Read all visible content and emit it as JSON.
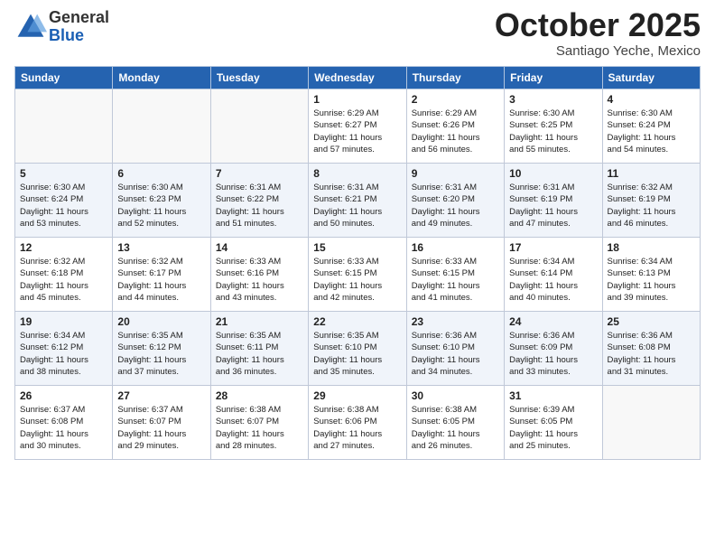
{
  "header": {
    "logo_general": "General",
    "logo_blue": "Blue",
    "month": "October 2025",
    "location": "Santiago Yeche, Mexico"
  },
  "weekdays": [
    "Sunday",
    "Monday",
    "Tuesday",
    "Wednesday",
    "Thursday",
    "Friday",
    "Saturday"
  ],
  "weeks": [
    [
      {
        "day": "",
        "info": ""
      },
      {
        "day": "",
        "info": ""
      },
      {
        "day": "",
        "info": ""
      },
      {
        "day": "1",
        "info": "Sunrise: 6:29 AM\nSunset: 6:27 PM\nDaylight: 11 hours\nand 57 minutes."
      },
      {
        "day": "2",
        "info": "Sunrise: 6:29 AM\nSunset: 6:26 PM\nDaylight: 11 hours\nand 56 minutes."
      },
      {
        "day": "3",
        "info": "Sunrise: 6:30 AM\nSunset: 6:25 PM\nDaylight: 11 hours\nand 55 minutes."
      },
      {
        "day": "4",
        "info": "Sunrise: 6:30 AM\nSunset: 6:24 PM\nDaylight: 11 hours\nand 54 minutes."
      }
    ],
    [
      {
        "day": "5",
        "info": "Sunrise: 6:30 AM\nSunset: 6:24 PM\nDaylight: 11 hours\nand 53 minutes."
      },
      {
        "day": "6",
        "info": "Sunrise: 6:30 AM\nSunset: 6:23 PM\nDaylight: 11 hours\nand 52 minutes."
      },
      {
        "day": "7",
        "info": "Sunrise: 6:31 AM\nSunset: 6:22 PM\nDaylight: 11 hours\nand 51 minutes."
      },
      {
        "day": "8",
        "info": "Sunrise: 6:31 AM\nSunset: 6:21 PM\nDaylight: 11 hours\nand 50 minutes."
      },
      {
        "day": "9",
        "info": "Sunrise: 6:31 AM\nSunset: 6:20 PM\nDaylight: 11 hours\nand 49 minutes."
      },
      {
        "day": "10",
        "info": "Sunrise: 6:31 AM\nSunset: 6:19 PM\nDaylight: 11 hours\nand 47 minutes."
      },
      {
        "day": "11",
        "info": "Sunrise: 6:32 AM\nSunset: 6:19 PM\nDaylight: 11 hours\nand 46 minutes."
      }
    ],
    [
      {
        "day": "12",
        "info": "Sunrise: 6:32 AM\nSunset: 6:18 PM\nDaylight: 11 hours\nand 45 minutes."
      },
      {
        "day": "13",
        "info": "Sunrise: 6:32 AM\nSunset: 6:17 PM\nDaylight: 11 hours\nand 44 minutes."
      },
      {
        "day": "14",
        "info": "Sunrise: 6:33 AM\nSunset: 6:16 PM\nDaylight: 11 hours\nand 43 minutes."
      },
      {
        "day": "15",
        "info": "Sunrise: 6:33 AM\nSunset: 6:15 PM\nDaylight: 11 hours\nand 42 minutes."
      },
      {
        "day": "16",
        "info": "Sunrise: 6:33 AM\nSunset: 6:15 PM\nDaylight: 11 hours\nand 41 minutes."
      },
      {
        "day": "17",
        "info": "Sunrise: 6:34 AM\nSunset: 6:14 PM\nDaylight: 11 hours\nand 40 minutes."
      },
      {
        "day": "18",
        "info": "Sunrise: 6:34 AM\nSunset: 6:13 PM\nDaylight: 11 hours\nand 39 minutes."
      }
    ],
    [
      {
        "day": "19",
        "info": "Sunrise: 6:34 AM\nSunset: 6:12 PM\nDaylight: 11 hours\nand 38 minutes."
      },
      {
        "day": "20",
        "info": "Sunrise: 6:35 AM\nSunset: 6:12 PM\nDaylight: 11 hours\nand 37 minutes."
      },
      {
        "day": "21",
        "info": "Sunrise: 6:35 AM\nSunset: 6:11 PM\nDaylight: 11 hours\nand 36 minutes."
      },
      {
        "day": "22",
        "info": "Sunrise: 6:35 AM\nSunset: 6:10 PM\nDaylight: 11 hours\nand 35 minutes."
      },
      {
        "day": "23",
        "info": "Sunrise: 6:36 AM\nSunset: 6:10 PM\nDaylight: 11 hours\nand 34 minutes."
      },
      {
        "day": "24",
        "info": "Sunrise: 6:36 AM\nSunset: 6:09 PM\nDaylight: 11 hours\nand 33 minutes."
      },
      {
        "day": "25",
        "info": "Sunrise: 6:36 AM\nSunset: 6:08 PM\nDaylight: 11 hours\nand 31 minutes."
      }
    ],
    [
      {
        "day": "26",
        "info": "Sunrise: 6:37 AM\nSunset: 6:08 PM\nDaylight: 11 hours\nand 30 minutes."
      },
      {
        "day": "27",
        "info": "Sunrise: 6:37 AM\nSunset: 6:07 PM\nDaylight: 11 hours\nand 29 minutes."
      },
      {
        "day": "28",
        "info": "Sunrise: 6:38 AM\nSunset: 6:07 PM\nDaylight: 11 hours\nand 28 minutes."
      },
      {
        "day": "29",
        "info": "Sunrise: 6:38 AM\nSunset: 6:06 PM\nDaylight: 11 hours\nand 27 minutes."
      },
      {
        "day": "30",
        "info": "Sunrise: 6:38 AM\nSunset: 6:05 PM\nDaylight: 11 hours\nand 26 minutes."
      },
      {
        "day": "31",
        "info": "Sunrise: 6:39 AM\nSunset: 6:05 PM\nDaylight: 11 hours\nand 25 minutes."
      },
      {
        "day": "",
        "info": ""
      }
    ]
  ]
}
